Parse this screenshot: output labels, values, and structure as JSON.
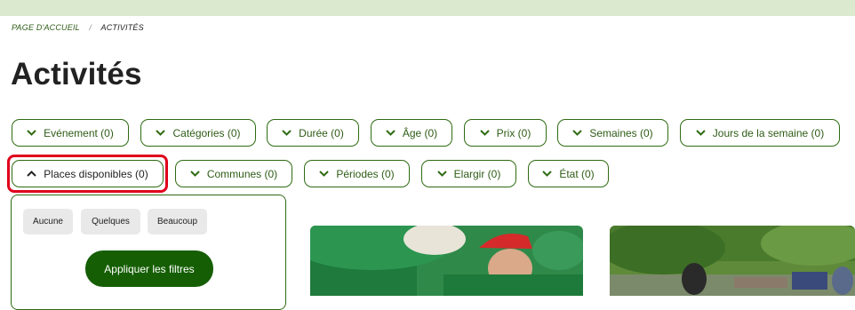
{
  "breadcrumb": {
    "home": "PAGE D'ACCUEIL",
    "separator": "/",
    "current": "ACTIVITÉS"
  },
  "page": {
    "title": "Activités"
  },
  "filters": {
    "row1": [
      {
        "label": "Evénement (0)"
      },
      {
        "label": "Catégories (0)"
      },
      {
        "label": "Durée (0)"
      },
      {
        "label": "Âge (0)"
      },
      {
        "label": "Prix (0)"
      },
      {
        "label": "Semaines (0)"
      },
      {
        "label": "Jours de la semaine (0)"
      }
    ],
    "row2": [
      {
        "label": "Places disponibles (0)",
        "expanded": true
      },
      {
        "label": "Communes (0)"
      },
      {
        "label": "Périodes (0)"
      },
      {
        "label": "Elargir (0)"
      },
      {
        "label": "État (0)"
      }
    ]
  },
  "dropdown": {
    "options": [
      "Aucune",
      "Quelques",
      "Beaucoup"
    ],
    "apply_label": "Appliquer les filtres"
  },
  "colors": {
    "accent_green": "#2e6b12",
    "apply_button": "#155e04",
    "top_bar": "#dbe9cf",
    "highlight_red": "#e0001b"
  },
  "icons": {
    "collapsed": "chevron-down-icon",
    "expanded": "chevron-up-icon"
  }
}
